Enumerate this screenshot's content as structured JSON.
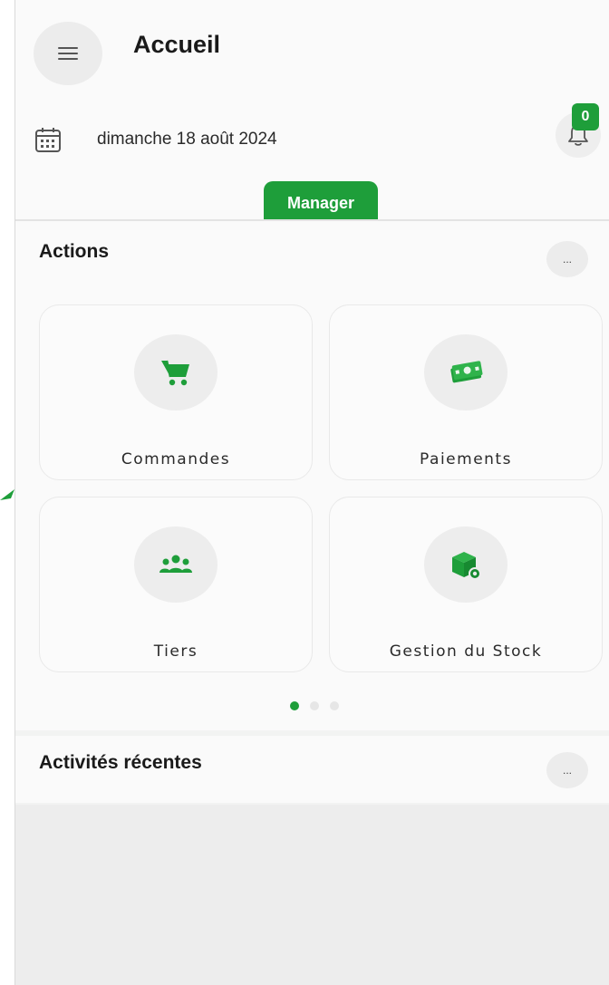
{
  "header": {
    "title": "Accueil",
    "date": "dimanche 18 août 2024",
    "notifications_count": "0",
    "role_tab": "Manager"
  },
  "actions": {
    "title": "Actions",
    "more_label": "...",
    "cards": [
      {
        "label": "Commandes",
        "icon": "cart-icon"
      },
      {
        "label": "Paiements",
        "icon": "money-icon"
      },
      {
        "label": "Tiers",
        "icon": "users-icon"
      },
      {
        "label": "Gestion du Stock",
        "icon": "package-icon"
      }
    ],
    "pager": {
      "pages": 3,
      "active": 1
    }
  },
  "recent": {
    "title": "Activités récentes",
    "more_label": "..."
  },
  "colors": {
    "accent": "#1e9e3a",
    "background": "#f2f3f2",
    "card": "#fbfbfb"
  }
}
